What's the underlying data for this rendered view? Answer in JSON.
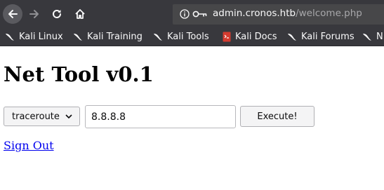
{
  "browser": {
    "url_domain": "admin.cronos.htb",
    "url_path": "/welcome.php",
    "icons": {
      "back": "back-arrow-icon",
      "forward": "forward-arrow-icon",
      "reload": "reload-icon",
      "home": "home-icon",
      "info": "info-icon",
      "key": "key-icon"
    }
  },
  "bookmarks": [
    {
      "label": "Kali Linux",
      "icon": "kali-dragon-icon"
    },
    {
      "label": "Kali Training",
      "icon": "kali-dragon-icon"
    },
    {
      "label": "Kali Tools",
      "icon": "kali-dragon-icon"
    },
    {
      "label": "Kali Docs",
      "icon": "docs-icon"
    },
    {
      "label": "Kali Forums",
      "icon": "kali-dragon-icon"
    },
    {
      "label": "N",
      "icon": "kali-dragon-icon"
    }
  ],
  "page": {
    "title": "Net Tool v0.1",
    "command_select": "traceroute",
    "host_value": "8.8.8.8",
    "execute_label": "Execute!",
    "signout_label": "Sign Out"
  },
  "colors": {
    "toolbar_bg": "#38383d",
    "urlbar_bg": "#474749",
    "link": "#0000ee"
  }
}
